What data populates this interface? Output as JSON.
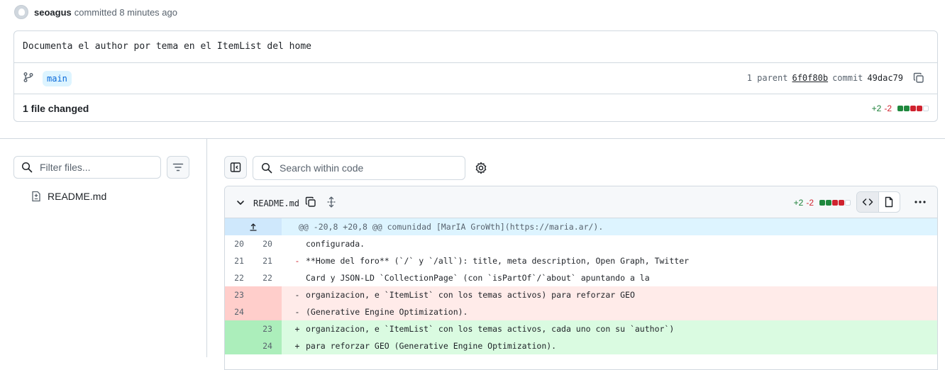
{
  "author": {
    "name": "seoagus",
    "action": "committed 8 minutes ago"
  },
  "commit": {
    "message": "Documenta el author por tema en el ItemList del home",
    "branch": "main",
    "parent_label": "1 parent",
    "parent_sha": "6f0f80b",
    "commit_label": "commit",
    "commit_sha": "49dac79",
    "files_changed": "1 file changed",
    "additions": "+2",
    "deletions": "-2"
  },
  "sidebar": {
    "filter_placeholder": "Filter files...",
    "files": [
      {
        "name": "README.md"
      }
    ]
  },
  "toolbar": {
    "search_placeholder": "Search within code"
  },
  "diff_file": {
    "filename": "README.md",
    "additions": "+2",
    "deletions": "-2",
    "hunk_header": "@@ -20,8 +20,8 @@ comunidad [MarIA GroWth](https://maria.ar/).",
    "lines": [
      {
        "type": "ctx",
        "old": "20",
        "new": "20",
        "sign": "",
        "text": "configurada."
      },
      {
        "type": "ctx",
        "old": "21",
        "new": "21",
        "sign": "-",
        "text": "**Home del foro** (`/` y `/all`): title, meta description, Open Graph, Twitter"
      },
      {
        "type": "ctx",
        "old": "22",
        "new": "22",
        "sign": "",
        "text": "Card y JSON-LD `CollectionPage` (con `isPartOf`/`about` apuntando a la"
      },
      {
        "type": "del",
        "old": "23",
        "new": "",
        "sign": "-",
        "text": "organizacion, e `ItemList` con los temas activos) para reforzar GEO"
      },
      {
        "type": "del",
        "old": "24",
        "new": "",
        "sign": "-",
        "text": "(Generative Engine Optimization)."
      },
      {
        "type": "add",
        "old": "",
        "new": "23",
        "sign": "+",
        "text": "organizacion, e `ItemList` con los temas activos, cada uno con su `author`)"
      },
      {
        "type": "add",
        "old": "",
        "new": "24",
        "sign": "+",
        "text": "para reforzar GEO (Generative Engine Optimization)."
      }
    ]
  },
  "colors": {
    "add": "#1a7f37",
    "del": "#d1242f",
    "accent": "#0969da"
  }
}
